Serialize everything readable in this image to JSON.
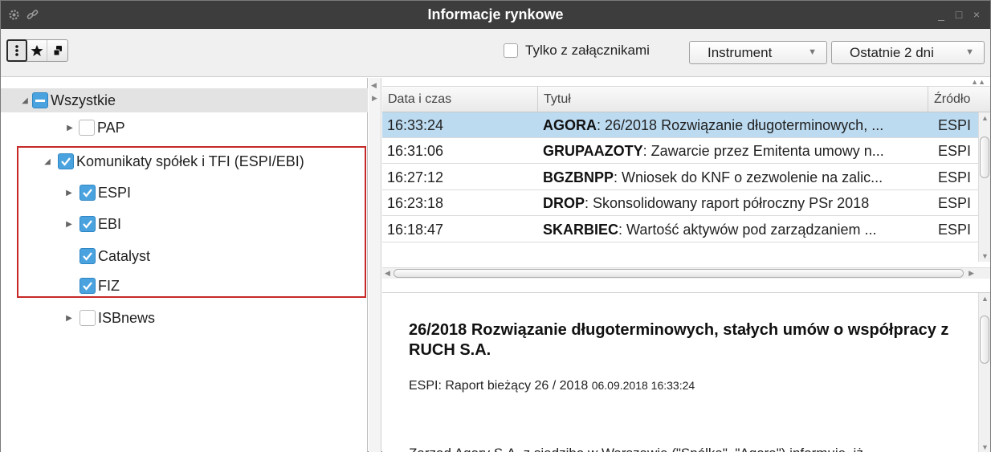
{
  "window": {
    "title": "Informacje rynkowe",
    "minimize_glyph": "_",
    "restore_glyph": "□",
    "close_glyph": "×"
  },
  "toolbar": {
    "view_buttons": [
      "list-view-icon",
      "favorites-star-icon",
      "group-icon"
    ],
    "attachments_label": "Tylko z załącznikami",
    "attachments_checked": false,
    "instrument_label": "Instrument",
    "period_label": "Ostatnie 2 dni"
  },
  "tree": {
    "root": {
      "label": "Wszystkie",
      "state": "partial"
    },
    "items": [
      {
        "label": "PAP",
        "state": "unchecked",
        "expandable": true,
        "expanded": false
      },
      {
        "label": "Komunikaty spółek i TFI (ESPI/EBI)",
        "state": "checked",
        "expandable": true,
        "expanded": true
      },
      {
        "label": "ESPI",
        "state": "checked",
        "expandable": true,
        "expanded": false
      },
      {
        "label": "EBI",
        "state": "checked",
        "expandable": true,
        "expanded": false
      },
      {
        "label": "Catalyst",
        "state": "checked",
        "expandable": false
      },
      {
        "label": "FIZ",
        "state": "checked",
        "expandable": false
      },
      {
        "label": "ISBnews",
        "state": "unchecked",
        "expandable": true,
        "expanded": false
      }
    ]
  },
  "news_table": {
    "columns": [
      "Data i czas",
      "Tytuł",
      "Źródło"
    ],
    "rows": [
      {
        "time": "16:33:24",
        "company": "AGORA",
        "title": ": 26/2018 Rozwiązanie długoterminowych, ...",
        "source": "ESPI",
        "selected": true
      },
      {
        "time": "16:31:06",
        "company": "GRUPAAZOTY",
        "title": ": Zawarcie przez Emitenta umowy n...",
        "source": "ESPI",
        "selected": false
      },
      {
        "time": "16:27:12",
        "company": "BGZBNPP",
        "title": ": Wniosek do KNF o zezwolenie na zalic...",
        "source": "ESPI",
        "selected": false
      },
      {
        "time": "16:23:18",
        "company": "DROP",
        "title": ": Skonsolidowany raport półroczny PSr 2018",
        "source": "ESPI",
        "selected": false
      },
      {
        "time": "16:18:47",
        "company": "SKARBIEC",
        "title": ": Wartość aktywów pod zarządzaniem ...",
        "source": "ESPI",
        "selected": false
      }
    ]
  },
  "detail": {
    "headline": "26/2018 Rozwiązanie długoterminowych, stałych umów o współpracy z RUCH S.A.",
    "meta_prefix": "ESPI: Raport bieżący 26 / 2018",
    "meta_date": "06.09.2018 16:33:24",
    "body_start": "Zarząd Agory S.A. z siedzibą w Warszawie (\"Spółka\", \"Agora\") informuje, iż"
  }
}
